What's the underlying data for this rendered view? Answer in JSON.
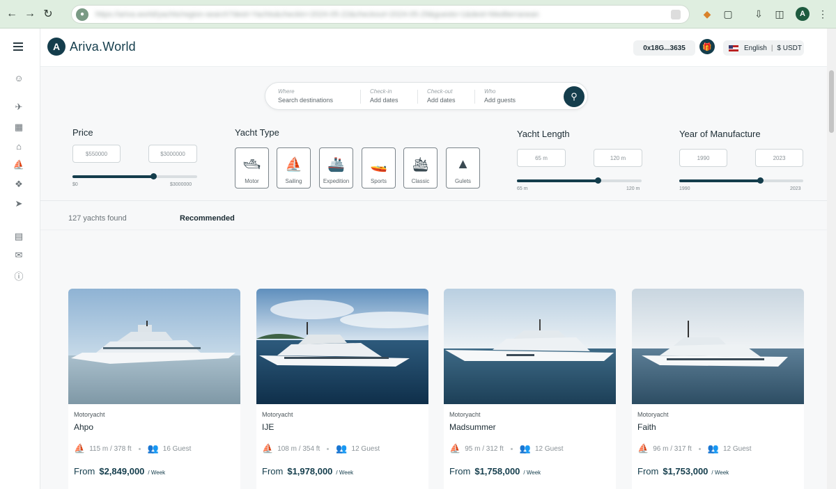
{
  "browser": {
    "url": "https://ariva.world/yachts/region-search?dest=Yachts&checkin=2024-05-22&checkout=2024-05-29&guests=1&dest=Mediterranean",
    "avatar_letter": "A"
  },
  "header": {
    "logo_letter": "A",
    "logo_text": "Ariva.World",
    "wallet": "0x18G...3635",
    "language": "English",
    "currency": "$ USDT"
  },
  "search": {
    "where_label": "Where",
    "where_value": "Search destinations",
    "checkin_label": "Check-in",
    "checkin_value": "Add dates",
    "checkout_label": "Check-out",
    "checkout_value": "Add dates",
    "who_label": "Who",
    "who_value": "Add guests"
  },
  "filters": {
    "price": {
      "title": "Price",
      "min_box": "$550000",
      "max_box": "$3000000",
      "min_label": "$0",
      "max_label": "$3000000",
      "position": 0.65
    },
    "yacht_type": {
      "title": "Yacht Type",
      "types": [
        "Motor",
        "Sailing",
        "Expedition",
        "Sports",
        "Classic",
        "Gulets"
      ]
    },
    "length": {
      "title": "Yacht Length",
      "min_box": "65 m",
      "max_box": "120 m",
      "min_label": "65 m",
      "max_label": "120 m",
      "position": 0.65
    },
    "year": {
      "title": "Year of Manufacture",
      "min_box": "1990",
      "max_box": "2023",
      "min_label": "1990",
      "max_label": "2023",
      "position": 0.65
    }
  },
  "results": {
    "count": "127 yachts found",
    "sort": "Recommended"
  },
  "yachts": [
    {
      "kind": "Motoryacht",
      "name": "Ahpo",
      "size": "115 m / 378 ft",
      "guests": "16 Guest",
      "from": "From",
      "price": "$2,849,000",
      "per": "/ Week"
    },
    {
      "kind": "Motoryacht",
      "name": "IJE",
      "size": "108 m / 354 ft",
      "guests": "12 Guest",
      "from": "From",
      "price": "$1,978,000",
      "per": "/ Week"
    },
    {
      "kind": "Motoryacht",
      "name": "Madsummer",
      "size": "95 m / 312 ft",
      "guests": "12 Guest",
      "from": "From",
      "price": "$1,758,000",
      "per": "/ Week"
    },
    {
      "kind": "Motoryacht",
      "name": "Faith",
      "size": "96 m / 317 ft",
      "guests": "12 Guest",
      "from": "From",
      "price": "$1,753,000",
      "per": "/ Week"
    }
  ],
  "colors": {
    "accent": "#143d4c",
    "chrome": "#dfeee0"
  }
}
